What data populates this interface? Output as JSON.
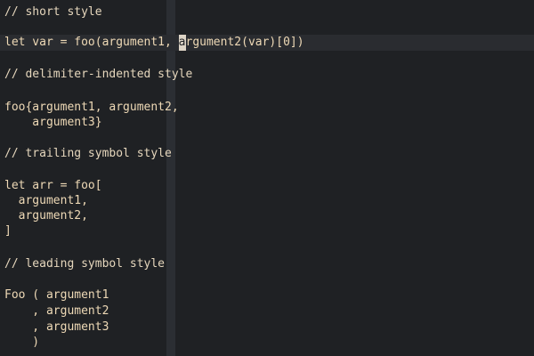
{
  "editor": {
    "lines": [
      {
        "text": "// short style",
        "kind": "comment"
      },
      {
        "before_cursor": "let var = foo(argument1, ",
        "cursor_char": "a",
        "after_cursor": "rgument2(var)[0])",
        "kind": "code"
      },
      {
        "text": "// delimiter-indented style",
        "kind": "comment"
      },
      {
        "text": "foo{argument1, argument2,",
        "kind": "code"
      },
      {
        "text": "    argument3}",
        "kind": "code"
      },
      {
        "text": "// trailing symbol style",
        "kind": "comment"
      },
      {
        "text": "let arr = foo[",
        "kind": "code"
      },
      {
        "text": "  argument1,",
        "kind": "code"
      },
      {
        "text": "  argument2,",
        "kind": "code"
      },
      {
        "text": "]",
        "kind": "code"
      },
      {
        "text": "// leading symbol style",
        "kind": "comment"
      },
      {
        "text": "Foo ( argument1",
        "kind": "code"
      },
      {
        "text": "    , argument2",
        "kind": "code"
      },
      {
        "text": "    , argument3",
        "kind": "code"
      },
      {
        "text": "    )",
        "kind": "code"
      }
    ]
  },
  "colors": {
    "background": "#1f2124",
    "text": "#eed9b6",
    "cursor": "#ddd4c6",
    "cursor_column": "#2b2e33",
    "cursor_line": "#2a2c30"
  }
}
